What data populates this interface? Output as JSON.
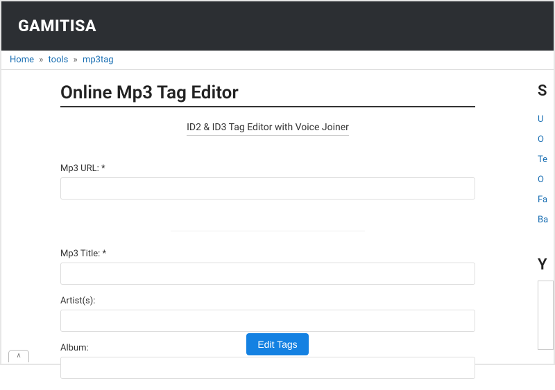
{
  "header": {
    "logo": "GAMITISA"
  },
  "breadcrumb": {
    "home": "Home",
    "tools": "tools",
    "current": "mp3tag",
    "sep": "»"
  },
  "page": {
    "title": "Online Mp3 Tag Editor",
    "subtitle": "ID2 & ID3 Tag Editor with Voice Joiner"
  },
  "form": {
    "url_label": "Mp3 URL: *",
    "url_value": "",
    "title_label": "Mp3 Title: *",
    "title_value": "",
    "artist_label": "Artist(s):",
    "artist_value": "",
    "album_label": "Album:",
    "album_value": "",
    "submit": "Edit Tags"
  },
  "sidebar": {
    "title1": "S",
    "links": [
      "U",
      "O",
      "Te",
      "O",
      "Fa",
      "Ba"
    ],
    "title2": "Y"
  },
  "corner": "∧"
}
